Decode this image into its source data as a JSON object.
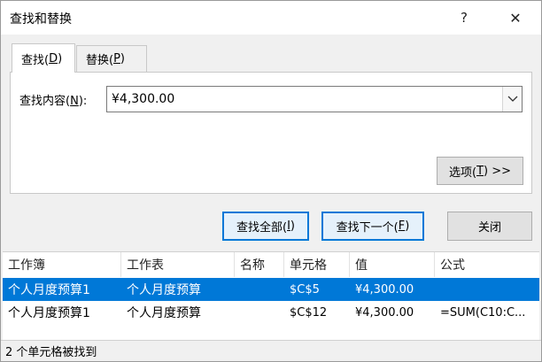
{
  "window": {
    "title": "查找和替换",
    "help_glyph": "?",
    "close_glyph": "✕"
  },
  "tabs": [
    {
      "label": "查找(",
      "hotkey": "D",
      "suffix": ")"
    },
    {
      "label": "替换(",
      "hotkey": "P",
      "suffix": ")"
    }
  ],
  "find": {
    "label_prefix": "查找内容(",
    "label_hotkey": "N",
    "label_suffix": "):",
    "value": "¥4,300.00",
    "arrow_glyph": "⌵"
  },
  "options_button": {
    "label_prefix": "选项(",
    "label_hotkey": "T",
    "label_suffix": ") >>"
  },
  "buttons": {
    "find_all": {
      "prefix": "查找全部(",
      "hotkey": "I",
      "suffix": ")"
    },
    "find_next": {
      "prefix": "查找下一个(",
      "hotkey": "F",
      "suffix": ")"
    },
    "close": "关闭"
  },
  "results": {
    "columns": [
      "工作簿",
      "工作表",
      "名称",
      "单元格",
      "值",
      "公式"
    ],
    "rows": [
      {
        "workbook": "个人月度预算1",
        "sheet": "个人月度预算",
        "name": "",
        "cell": "$C$5",
        "value": "¥4,300.00",
        "formula": ""
      },
      {
        "workbook": "个人月度预算1",
        "sheet": "个人月度预算",
        "name": "",
        "cell": "$C$12",
        "value": "¥4,300.00",
        "formula": "=SUM(C10:C..."
      }
    ]
  },
  "status": "2 个单元格被找到",
  "colors": {
    "selection": "#0078d7",
    "dialog_bg": "#f0f0f0",
    "panel_bg": "#ffffff"
  }
}
